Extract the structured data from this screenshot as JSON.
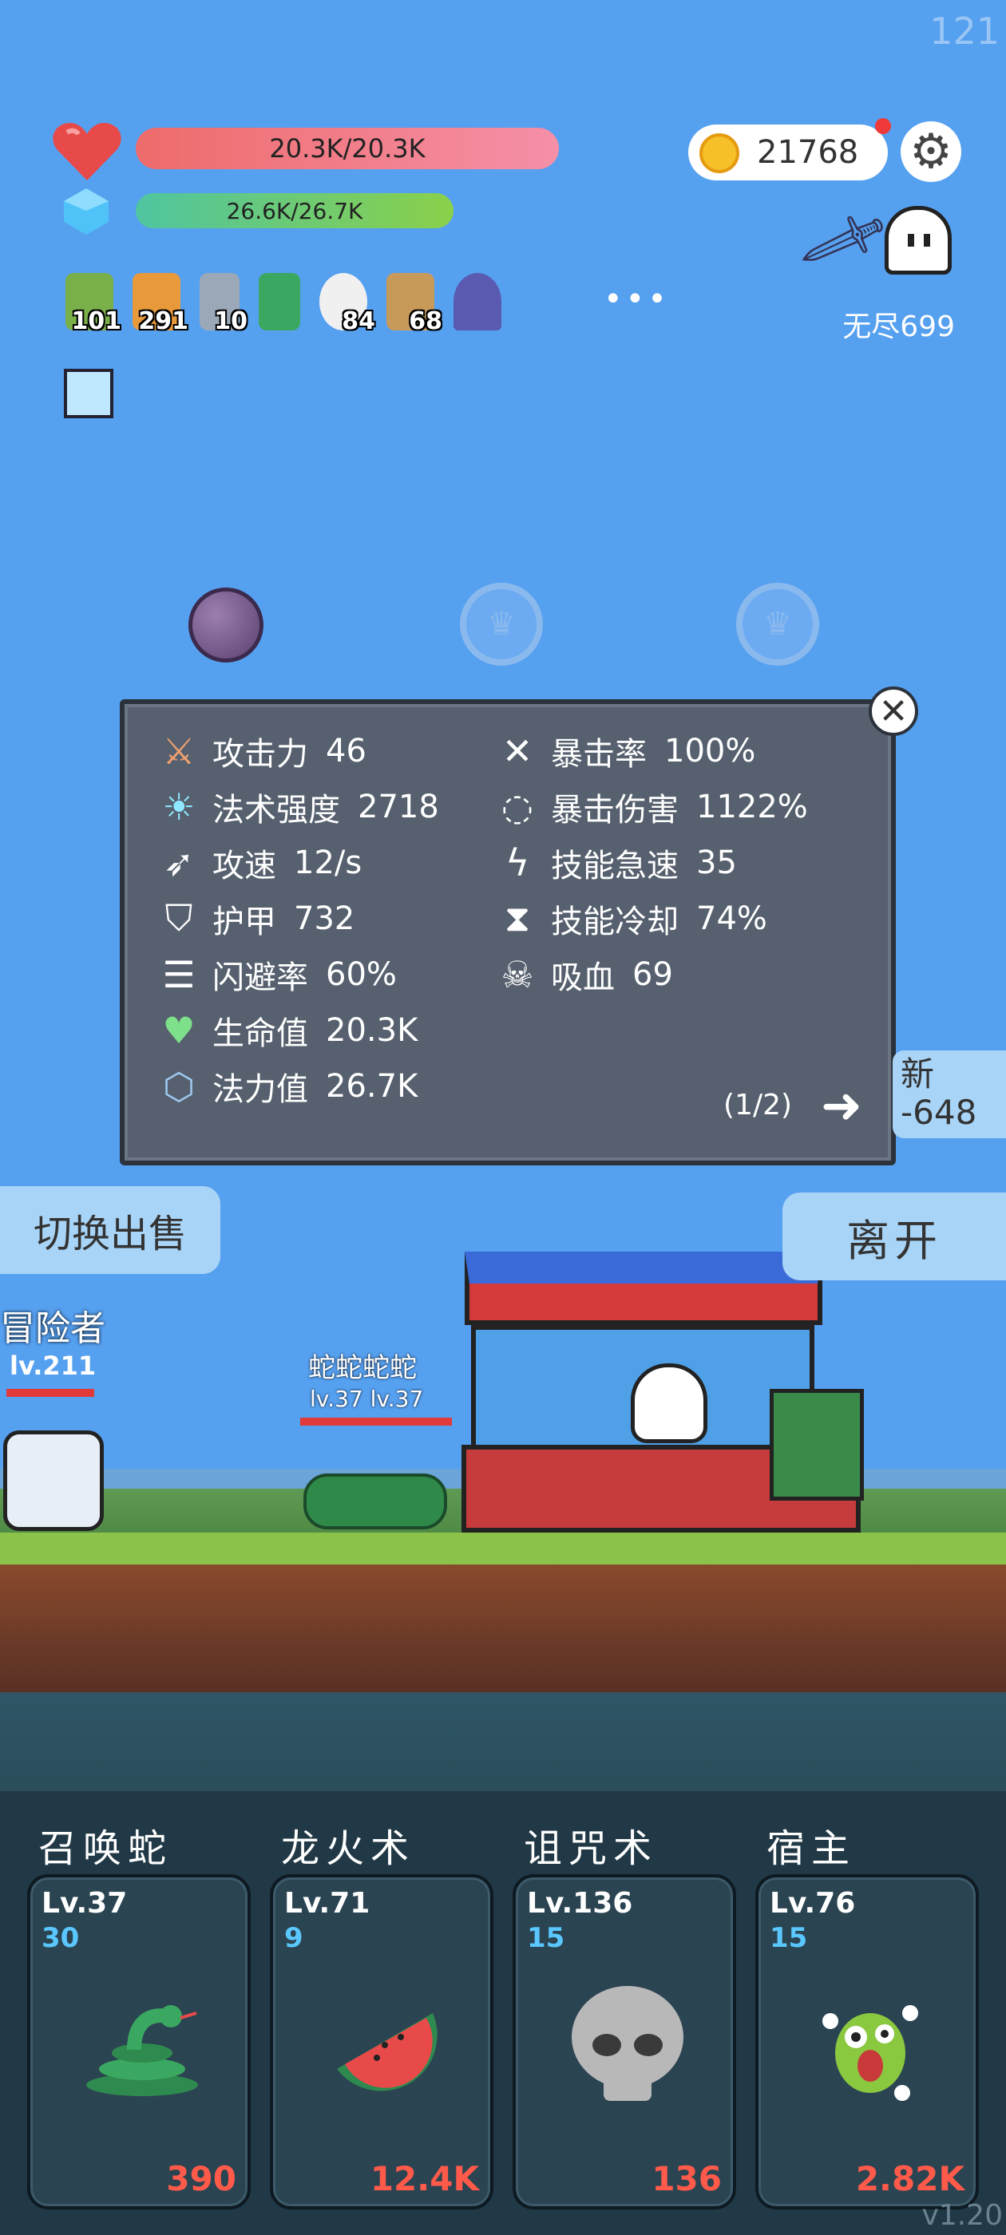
{
  "fps": "121",
  "player": {
    "hp": "20.3K/20.3K",
    "mp": "26.6K/26.7K"
  },
  "gold": "21768",
  "endless": "无尽699",
  "inventory": [
    {
      "icon": "potion-icon",
      "count": "101"
    },
    {
      "icon": "book-icon",
      "count": "291"
    },
    {
      "icon": "dagger-icon",
      "count": "10"
    },
    {
      "icon": "scroll-icon",
      "count": ""
    },
    {
      "icon": "flower-icon",
      "count": "84"
    },
    {
      "icon": "bow-icon",
      "count": "68"
    },
    {
      "icon": "wizard-hat-icon",
      "count": ""
    }
  ],
  "more": "•••",
  "stats": {
    "left": [
      {
        "icon": "axe-icon",
        "label": "攻击力",
        "value": "46"
      },
      {
        "icon": "sun-icon",
        "label": "法术强度",
        "value": "2718"
      },
      {
        "icon": "crossbow-icon",
        "label": "攻速",
        "value": "12/s"
      },
      {
        "icon": "shield-icon",
        "label": "护甲",
        "value": "732"
      },
      {
        "icon": "dodge-icon",
        "label": "闪避率",
        "value": "60%"
      },
      {
        "icon": "heart-icon",
        "label": "生命值",
        "value": "20.3K"
      },
      {
        "icon": "hexagon-icon",
        "label": "法力值",
        "value": "26.7K"
      }
    ],
    "right": [
      {
        "icon": "crit-icon",
        "label": "暴击率",
        "value": "100%"
      },
      {
        "icon": "crit-damage-icon",
        "label": "暴击伤害",
        "value": "1122%"
      },
      {
        "icon": "lightning-icon",
        "label": "技能急速",
        "value": "35"
      },
      {
        "icon": "hourglass-icon",
        "label": "技能冷却",
        "value": "74%"
      },
      {
        "icon": "skull-icon",
        "label": "吸血",
        "value": "69"
      }
    ],
    "page": "(1/2)"
  },
  "badge": {
    "line1": "新",
    "line2": "-648"
  },
  "buttons": {
    "switch_sell": "切换出售",
    "leave": "离开"
  },
  "scene": {
    "adventurer": "冒险者",
    "adventurer_lv": "lv.211",
    "snake_label": "蛇蛇蛇蛇",
    "snake_lv": "lv.37 lv.37"
  },
  "skills": [
    {
      "name": "召唤蛇",
      "lv": "Lv.37",
      "cost": "30",
      "damage": "390",
      "icon": "snake-icon",
      "color": "#3aa860"
    },
    {
      "name": "龙火术",
      "lv": "Lv.71",
      "cost": "9",
      "damage": "12.4K",
      "icon": "watermelon-icon",
      "color": "#e84a4a"
    },
    {
      "name": "诅咒术",
      "lv": "Lv.136",
      "cost": "15",
      "damage": "136",
      "icon": "skull-icon",
      "color": "#b8b8b8"
    },
    {
      "name": "宿主",
      "lv": "Lv.76",
      "cost": "15",
      "damage": "2.82K",
      "icon": "monster-icon",
      "color": "#8ac840"
    }
  ],
  "version": "v1.20"
}
